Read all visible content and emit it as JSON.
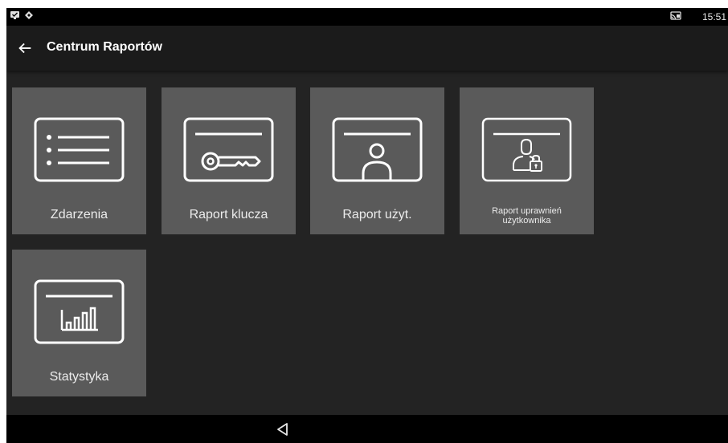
{
  "status_bar": {
    "time": "15:51",
    "icons": [
      "notification-check-icon",
      "nav-diamond-icon",
      "cast-icon"
    ]
  },
  "app_bar": {
    "back_icon": "arrow-left-icon",
    "title": "Centrum Raportów"
  },
  "tiles": [
    {
      "label": "Zdarzenia",
      "icon": "list-icon"
    },
    {
      "label": "Raport klucza",
      "icon": "key-card-icon"
    },
    {
      "label": "Raport użyt.",
      "icon": "user-card-icon"
    },
    {
      "label_line1": "Raport uprawnień",
      "label_line2": "użytkownika",
      "icon": "user-lock-card-icon"
    },
    {
      "label": "Statystyka",
      "icon": "bar-chart-card-icon"
    }
  ],
  "nav_bar": {
    "back_icon": "triangle-back-icon"
  },
  "colors": {
    "background": "#232323",
    "tile": "#5a5a5a",
    "app_bar": "#1b1b1b",
    "text": "#ffffff"
  }
}
